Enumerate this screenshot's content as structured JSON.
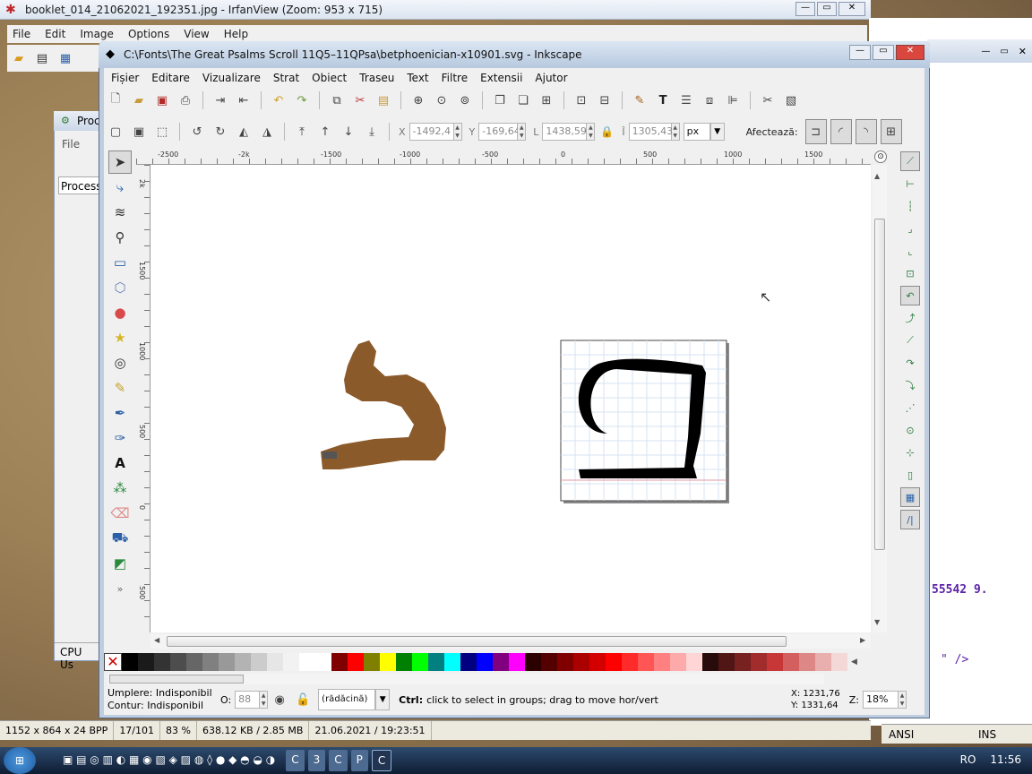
{
  "irfanview": {
    "title": "booklet_014_21062021_192351.jpg - IrfanView (Zoom: 953 x 715)",
    "menu": [
      "File",
      "Edit",
      "Image",
      "Options",
      "View",
      "Help"
    ],
    "status": [
      "1152 x 864 x 24 BPP",
      "17/101",
      "83 %",
      "638.12 KB / 2.85 MB",
      "21.06.2021 / 19:23:51"
    ]
  },
  "process_window": {
    "title": "Proc",
    "menu": "File",
    "tab": "Process",
    "status": "CPU Us"
  },
  "right_window": {
    "code_line1": "55542 9.",
    "code_line2": "\" />",
    "status": [
      "ANSI",
      "INS"
    ]
  },
  "inkscape": {
    "title": "C:\\Fonts\\The Great Psalms Scroll 11Q5–11QPsa\\betphoenician-x10901.svg - Inkscape",
    "menu": [
      "Fișier",
      "Editare",
      "Vizualizare",
      "Strat",
      "Obiect",
      "Traseu",
      "Text",
      "Filtre",
      "Extensii",
      "Ajutor"
    ],
    "controls": {
      "x_label": "X",
      "x_value": "-1492,4",
      "y_label": "Y",
      "y_value": "-169,64",
      "w_label": "L",
      "w_value": "1438,59",
      "h_label": "Î",
      "h_value": "1305,43",
      "unit": "px",
      "affect_label": "Afectează:"
    },
    "ruler_h": [
      "-2500",
      "-2k",
      "-1500",
      "-1000",
      "-500",
      "0",
      "500",
      "1000",
      "1500"
    ],
    "ruler_v": [
      "2k",
      "1500",
      "1000",
      "500",
      "0",
      "500"
    ],
    "status": {
      "fill_label": "Umplere:",
      "fill_value": "Indisponibil",
      "stroke_label": "Contur:",
      "stroke_value": "Indisponibil",
      "opacity_label": "O:",
      "opacity_value": "88",
      "layer": "(rădăcină)",
      "message_key": "Ctrl:",
      "message": "click to select in groups; drag to move hor/vert",
      "x_coord": "X: 1231,76",
      "y_coord": "Y: 1331,64",
      "zoom_label": "Z:",
      "zoom_value": "18%"
    },
    "palette": [
      "#000000",
      "#1a1a1a",
      "#333333",
      "#4d4d4d",
      "#666666",
      "#808080",
      "#999999",
      "#b3b3b3",
      "#cccccc",
      "#e6e6e6",
      "#f2f2f2",
      "#ffffff",
      "#ffffff",
      "#800000",
      "#ff0000",
      "#808000",
      "#ffff00",
      "#008000",
      "#00ff00",
      "#008080",
      "#00ffff",
      "#000080",
      "#0000ff",
      "#800080",
      "#ff00ff",
      "#2b0000",
      "#550000",
      "#800000",
      "#aa0000",
      "#d40000",
      "#ff0000",
      "#ff2a2a",
      "#ff5555",
      "#ff8080",
      "#ffaaaa",
      "#ffd5d5",
      "#280b0b",
      "#501616",
      "#782121",
      "#a02c2c",
      "#c83737",
      "#d35f5f",
      "#de8787",
      "#e9afaf",
      "#f4d7d7"
    ],
    "canvas": {
      "brown_glyph_color": "#8b5a2b",
      "black_glyph_color": "#000000"
    }
  },
  "taskbar": {
    "items": [
      "C",
      "3",
      "C",
      "P",
      "C"
    ],
    "lang": "RO",
    "time": "11:56"
  }
}
